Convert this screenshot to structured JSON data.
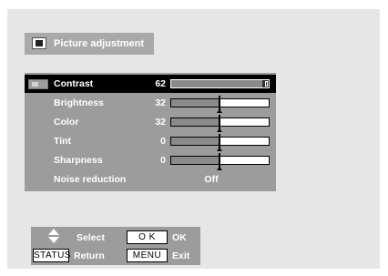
{
  "title": {
    "text": "Picture adjustment",
    "icon": "picture-adjust-icon"
  },
  "menu": {
    "items": [
      {
        "label": "Contrast",
        "value": "62",
        "level": 62,
        "selected": true
      },
      {
        "label": "Brightness",
        "value": "32",
        "level": 32
      },
      {
        "label": "Color",
        "value": "32",
        "level": 32
      },
      {
        "label": "Tint",
        "value": "0",
        "level": 0
      },
      {
        "label": "Sharpness",
        "value": "0",
        "level": 0
      },
      {
        "label": "Noise reduction",
        "value": "Off"
      }
    ]
  },
  "footer": {
    "select_label": "Select",
    "ok_key": "O K",
    "ok_label": "OK",
    "status_key": "STATUS",
    "return_label": "Return",
    "menu_key": "MENU",
    "exit_label": "Exit"
  },
  "colors": {
    "panel": "#9c9c9c",
    "selected_row": "#000000",
    "background": "#e6e6e6"
  }
}
